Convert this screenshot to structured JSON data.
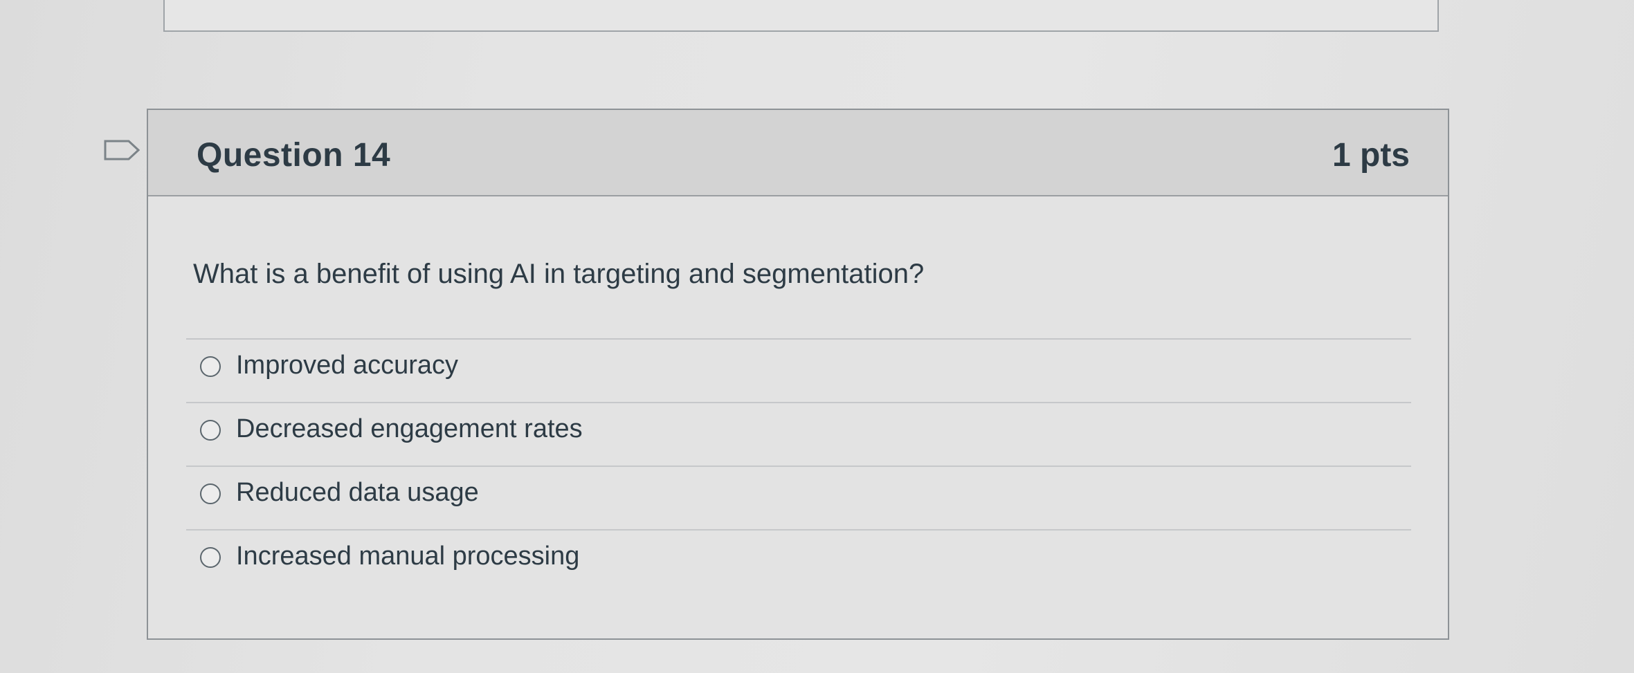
{
  "question": {
    "title": "Question 14",
    "points": "1 pts",
    "text": "What is a benefit of using AI in targeting and segmentation?",
    "flag_icon": "flag-outline-icon",
    "answers": [
      {
        "label": "Improved accuracy",
        "selected": false
      },
      {
        "label": "Decreased engagement rates",
        "selected": false
      },
      {
        "label": "Reduced data usage",
        "selected": false
      },
      {
        "label": "Increased manual processing",
        "selected": false
      }
    ]
  },
  "colors": {
    "text": "#2d3b45",
    "header_bg": "#d3d3d3",
    "card_border": "#8d9296"
  }
}
